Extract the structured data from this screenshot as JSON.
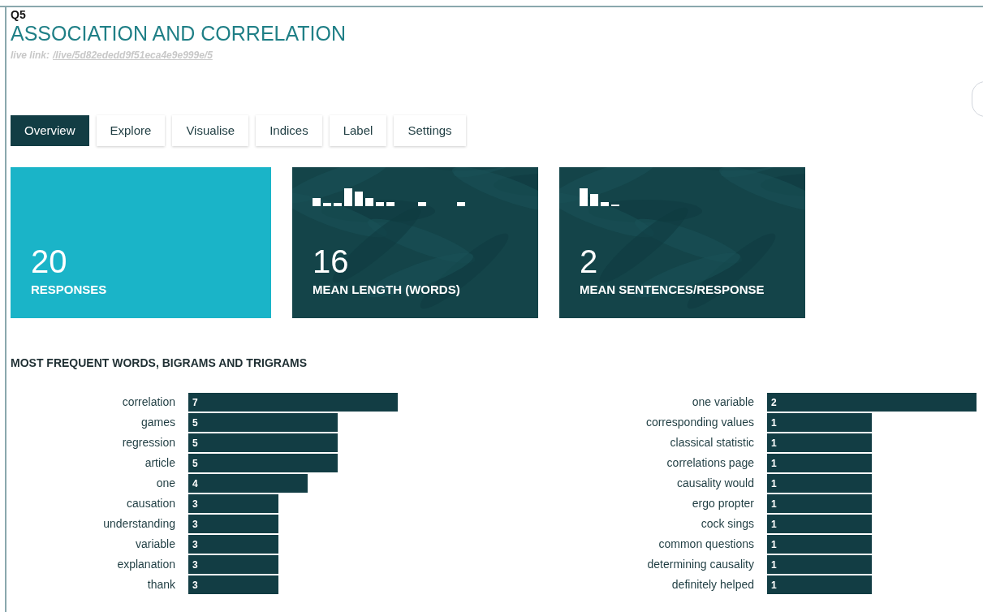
{
  "question": {
    "number": "Q5",
    "title": "ASSOCIATION AND CORRELATION",
    "live_link_label": "live link:",
    "live_link": "/live/5d82ededd9f51eca4e9e999e/5"
  },
  "tabs": [
    {
      "label": "Overview",
      "selected": true
    },
    {
      "label": "Explore",
      "selected": false
    },
    {
      "label": "Visualise",
      "selected": false
    },
    {
      "label": "Indices",
      "selected": false
    },
    {
      "label": "Label",
      "selected": false
    },
    {
      "label": "Settings",
      "selected": false
    }
  ],
  "cards": [
    {
      "kind": "plain",
      "value": "20",
      "label": "RESPONSES"
    },
    {
      "kind": "picture",
      "value": "16",
      "label": "MEAN LENGTH (WORDS)"
    },
    {
      "kind": "picture",
      "value": "2",
      "label": "MEAN SENTENCES/RESPONSE"
    }
  ],
  "frequent": {
    "heading": "MOST FREQUENT WORDS, BIGRAMS AND TRIGRAMS",
    "lists": [
      [
        {
          "term": "correlation",
          "count": "7"
        },
        {
          "term": "games",
          "count": "5"
        },
        {
          "term": "regression",
          "count": "5"
        },
        {
          "term": "article",
          "count": "5"
        },
        {
          "term": "one",
          "count": "4"
        },
        {
          "term": "causation",
          "count": "3"
        },
        {
          "term": "understanding",
          "count": "3"
        },
        {
          "term": "variable",
          "count": "3"
        },
        {
          "term": "explanation",
          "count": "3"
        },
        {
          "term": "thank",
          "count": "3"
        }
      ],
      [
        {
          "term": "one variable",
          "count": "2"
        },
        {
          "term": "corresponding values",
          "count": "1"
        },
        {
          "term": "classical statistic",
          "count": "1"
        },
        {
          "term": "correlations page",
          "count": "1"
        },
        {
          "term": "causality would",
          "count": "1"
        },
        {
          "term": "ergo propter",
          "count": "1"
        },
        {
          "term": "cock sings",
          "count": "1"
        },
        {
          "term": "common questions",
          "count": "1"
        },
        {
          "term": "determining causality",
          "count": "1"
        },
        {
          "term": "definitely helped",
          "count": "1"
        }
      ]
    ]
  }
}
